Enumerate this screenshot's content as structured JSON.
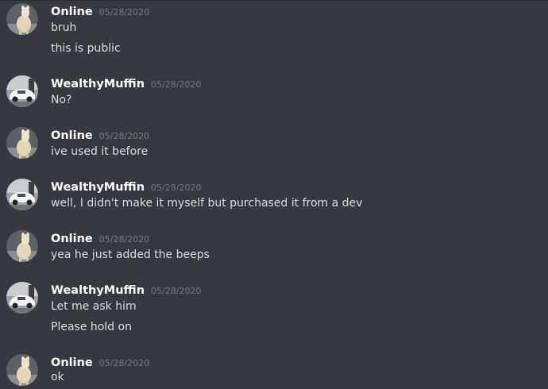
{
  "messages": [
    {
      "author": "Online",
      "timestamp": "05/28/2020",
      "avatar": "llama-avatar",
      "lines": [
        "bruh",
        "this is public"
      ]
    },
    {
      "author": "WealthyMuffin",
      "timestamp": "05/28/2020",
      "avatar": "car-avatar",
      "lines": [
        "No?"
      ]
    },
    {
      "author": "Online",
      "timestamp": "05/28/2020",
      "avatar": "llama-avatar",
      "lines": [
        "ive used it before"
      ]
    },
    {
      "author": "WealthyMuffin",
      "timestamp": "05/28/2020",
      "avatar": "car-avatar",
      "lines": [
        "well, I didn't make it myself but purchased it from a dev"
      ]
    },
    {
      "author": "Online",
      "timestamp": "05/28/2020",
      "avatar": "llama-avatar",
      "lines": [
        "yea he just added the beeps"
      ]
    },
    {
      "author": "WealthyMuffin",
      "timestamp": "05/28/2020",
      "avatar": "car-avatar",
      "lines": [
        "Let me ask him",
        "Please hold on"
      ]
    },
    {
      "author": "Online",
      "timestamp": "05/28/2020",
      "avatar": "llama-avatar",
      "lines": [
        "ok"
      ]
    }
  ],
  "colors": {
    "background": "#36393f",
    "username": "#ffffff",
    "timestamp": "#72767d",
    "message_text": "#dcddde"
  }
}
